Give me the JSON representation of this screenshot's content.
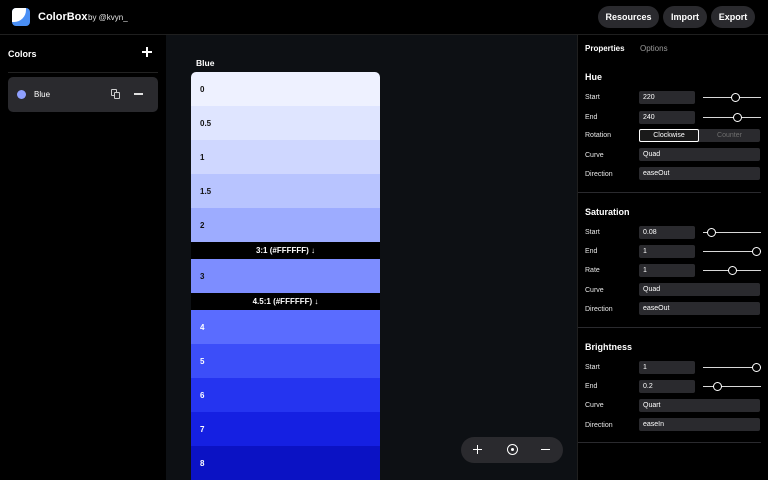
{
  "header": {
    "app_name": "ColorBox",
    "byline": "by @kvyn_",
    "buttons": {
      "resources": "Resources",
      "import": "Import",
      "export": "Export"
    }
  },
  "sidebar": {
    "title": "Colors",
    "items": [
      {
        "label": "Blue",
        "swatch": "#8fa0ff"
      }
    ]
  },
  "palette": {
    "name": "Blue",
    "steps": [
      {
        "label": "0",
        "color": "#eef1ff",
        "text": "#111111"
      },
      {
        "label": "0.5",
        "color": "#dfe5ff",
        "text": "#111111"
      },
      {
        "label": "1",
        "color": "#cfd7ff",
        "text": "#111111"
      },
      {
        "label": "1.5",
        "color": "#b8c4ff",
        "text": "#111111"
      },
      {
        "label": "2",
        "color": "#9dacff",
        "text": "#111111"
      },
      {
        "label": "3",
        "color": "#7d8dff",
        "text": "#111111"
      },
      {
        "label": "4",
        "color": "#5a6cff",
        "text": "#ffffff"
      },
      {
        "label": "5",
        "color": "#3c4ef9",
        "text": "#ffffff"
      },
      {
        "label": "6",
        "color": "#2534f0",
        "text": "#ffffff"
      },
      {
        "label": "7",
        "color": "#1520e2",
        "text": "#ffffff"
      },
      {
        "label": "8",
        "color": "#0b12c4",
        "text": "#ffffff"
      }
    ],
    "contrast_markers": [
      {
        "label": "3:1 (#FFFFFF) ↓"
      },
      {
        "label": "4.5:1 (#FFFFFF) ↓"
      }
    ]
  },
  "panel": {
    "tabs": [
      "Properties",
      "Options"
    ],
    "hue": {
      "title": "Hue",
      "start_label": "Start",
      "start": "220",
      "start_fraction": 0.58,
      "end_label": "End",
      "end": "240",
      "end_fraction": 0.61,
      "rotation_label": "Rotation",
      "rotation_options": [
        "Clockwise",
        "Counter"
      ],
      "curve_label": "Curve",
      "curve": "Quad",
      "direction_label": "Direction",
      "direction": "easeOut"
    },
    "saturation": {
      "title": "Saturation",
      "start_label": "Start",
      "start": "0.08",
      "start_fraction": 0.08,
      "end_label": "End",
      "end": "1",
      "end_fraction": 1,
      "rate_label": "Rate",
      "rate": "1",
      "rate_fraction": 0.5,
      "curve_label": "Curve",
      "curve": "Quad",
      "direction_label": "Direction",
      "direction": "easeOut"
    },
    "brightness": {
      "title": "Brightness",
      "start_label": "Start",
      "start": "1",
      "start_fraction": 1,
      "end_label": "End",
      "end": "0.2",
      "end_fraction": 0.2,
      "curve_label": "Curve",
      "curve": "Quart",
      "direction_label": "Direction",
      "direction": "easeIn"
    }
  }
}
